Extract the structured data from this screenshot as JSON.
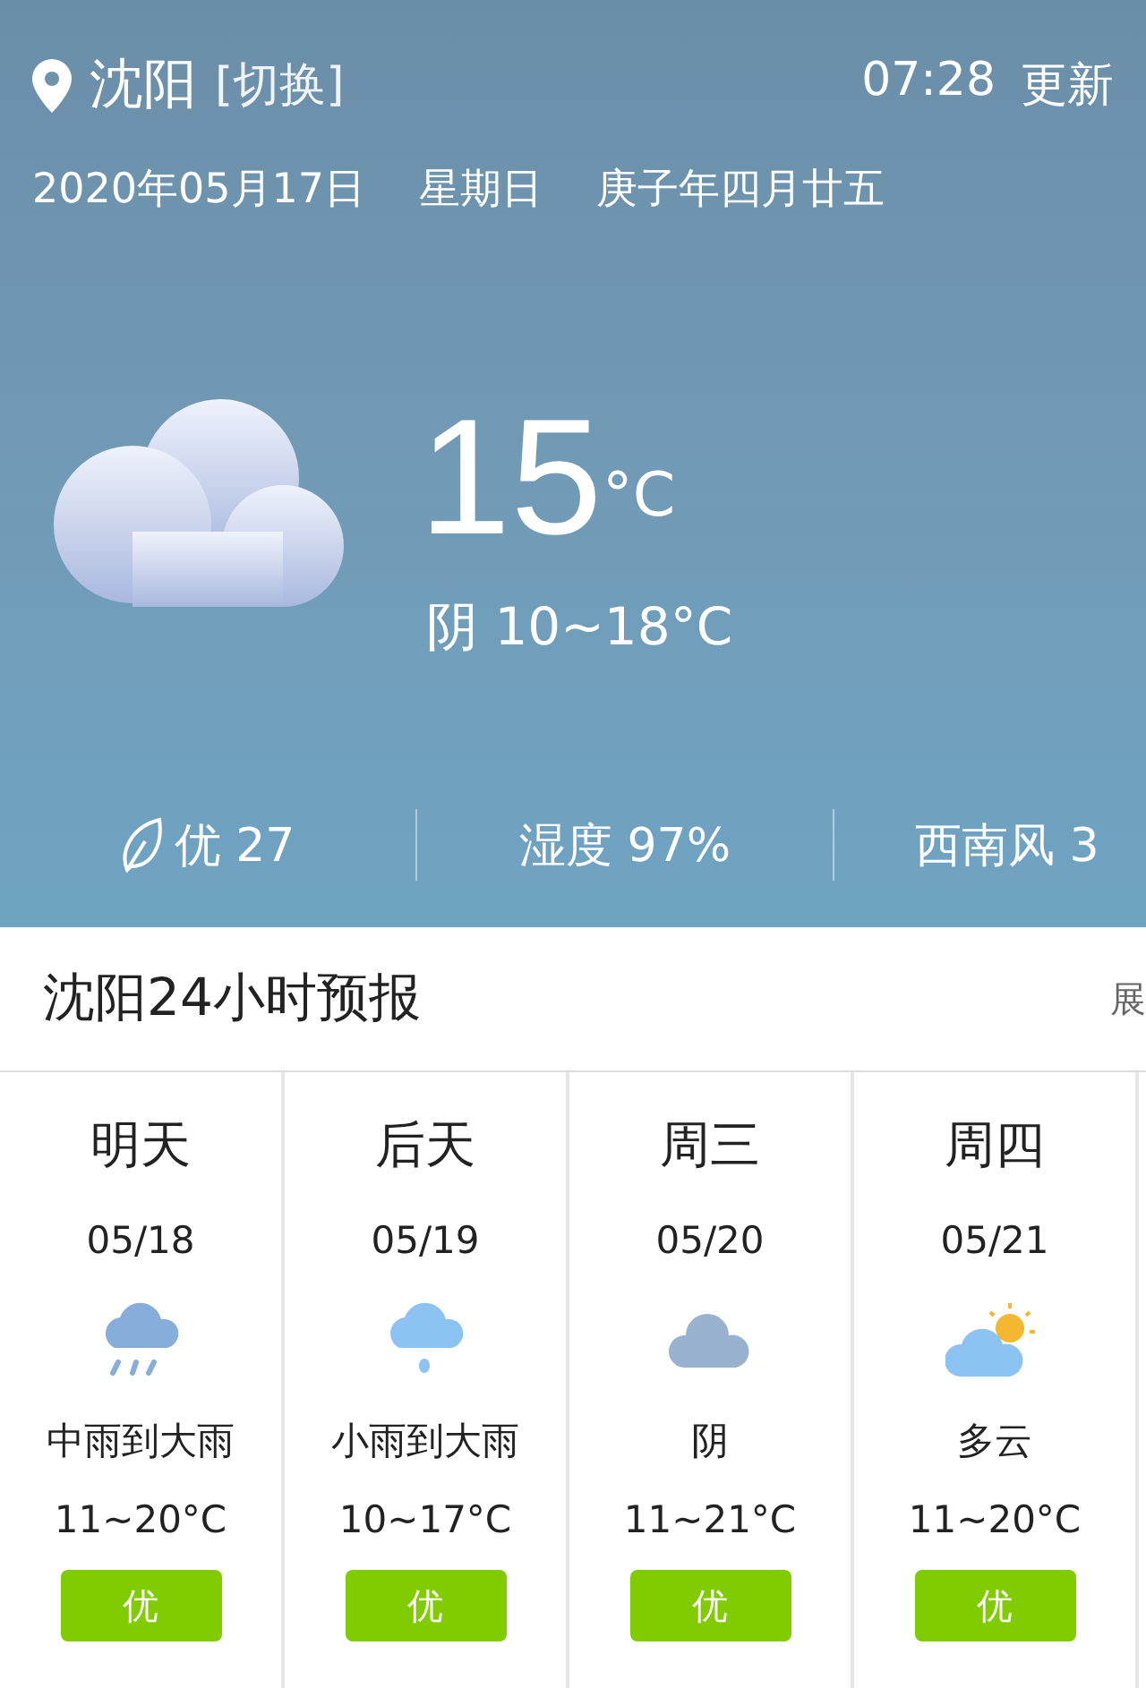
{
  "header": {
    "city": "沈阳",
    "switch": "[切换]",
    "time": "07:28",
    "refresh": "更新",
    "date": "2020年05月17日",
    "weekday": "星期日",
    "lunar": "庚子年四月廿五"
  },
  "current": {
    "temperature": "15",
    "unit": "°C",
    "summary": "阴 10~18°C"
  },
  "stats": [
    {
      "kind": "aqi",
      "text": "优 27"
    },
    {
      "kind": "plain",
      "text": "湿度 97%"
    },
    {
      "kind": "plain",
      "text": "西南风 3"
    }
  ],
  "forecast_title": "沈阳24小时预报",
  "expand": "展",
  "days": [
    {
      "day": "明天",
      "date": "05/18",
      "kind": "rain",
      "desc": "中雨到大雨",
      "temp": "11~20°C",
      "aqi": "优"
    },
    {
      "day": "后天",
      "date": "05/19",
      "kind": "light_rain",
      "desc": "小雨到大雨",
      "temp": "10~17°C",
      "aqi": "优"
    },
    {
      "day": "周三",
      "date": "05/20",
      "kind": "overcast",
      "desc": "阴",
      "temp": "11~21°C",
      "aqi": "优"
    },
    {
      "day": "周四",
      "date": "05/21",
      "kind": "partly_cloudy",
      "desc": "多云",
      "temp": "11~20°C",
      "aqi": "优"
    }
  ]
}
